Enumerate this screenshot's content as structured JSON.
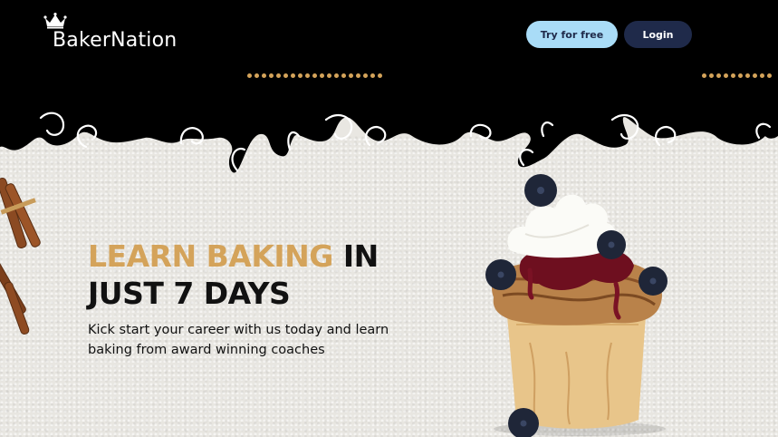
{
  "brand": {
    "name": "BakerNation"
  },
  "nav": {
    "try_label": "Try for free",
    "login_label": "Login"
  },
  "hero": {
    "title_accent": "LEARN BAKING",
    "title_rest_1": " IN",
    "title_line_2": "JUST 7 DAYS",
    "subtitle_line_1": "Kick start your career with us today and learn",
    "subtitle_line_2": "baking from award winning coaches"
  },
  "colors": {
    "header": "#000000",
    "accent": "#d4a35a",
    "try_button": "#a9dcf7",
    "login_button": "#1f2a4a"
  },
  "icons": [
    "crown-icon"
  ]
}
